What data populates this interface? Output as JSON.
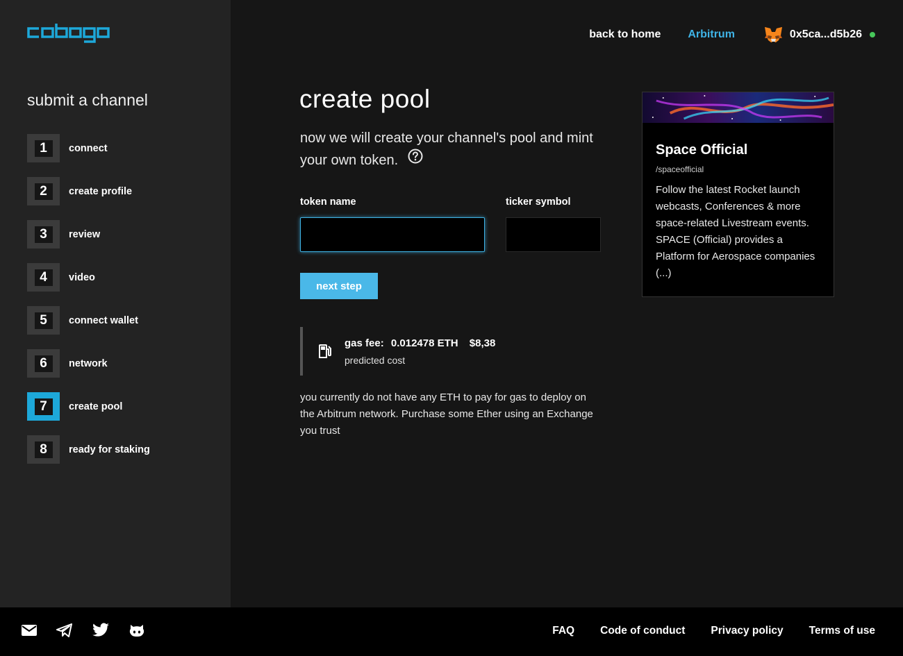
{
  "brand": {
    "logo_text": "cobogo",
    "accent_color": "#1da8d9"
  },
  "sidebar": {
    "title": "submit a channel",
    "steps": [
      {
        "number": "1",
        "label": "connect"
      },
      {
        "number": "2",
        "label": "create profile"
      },
      {
        "number": "3",
        "label": "review"
      },
      {
        "number": "4",
        "label": "video"
      },
      {
        "number": "5",
        "label": "connect wallet"
      },
      {
        "number": "6",
        "label": "network"
      },
      {
        "number": "7",
        "label": "create pool",
        "active": true
      },
      {
        "number": "8",
        "label": "ready for staking"
      }
    ]
  },
  "header": {
    "home_link": "back to home",
    "network": "Arbitrum",
    "wallet_icon": "metamask-fox-icon",
    "wallet_address": "0x5ca...d5b26",
    "status_color": "#47c75a"
  },
  "main": {
    "title": "create pool",
    "intro": "now we will create your channel's pool and mint your own token.",
    "token_name_label": "token name",
    "token_name_value": "",
    "ticker_label": "ticker symbol",
    "ticker_value": "",
    "next_button": "next step",
    "gas": {
      "label": "gas fee:",
      "eth": "0.012478 ETH",
      "usd": "$8,38",
      "sub": "predicted cost"
    },
    "warning": "you currently do not have any ETH to pay for gas to deploy on the Arbitrum network. Purchase some Ether using an Exchange you trust"
  },
  "card": {
    "title": "Space Official",
    "handle": "/spaceofficial",
    "description": "Follow the latest Rocket launch webcasts, Conferences & more space-related Livestream events. SPACE (Official) provides a Platform for Aerospace companies (...)"
  },
  "footer": {
    "icons": [
      "mail-icon",
      "telegram-icon",
      "twitter-icon",
      "github-icon"
    ],
    "links": [
      "FAQ",
      "Code of conduct",
      "Privacy policy",
      "Terms of use"
    ]
  }
}
